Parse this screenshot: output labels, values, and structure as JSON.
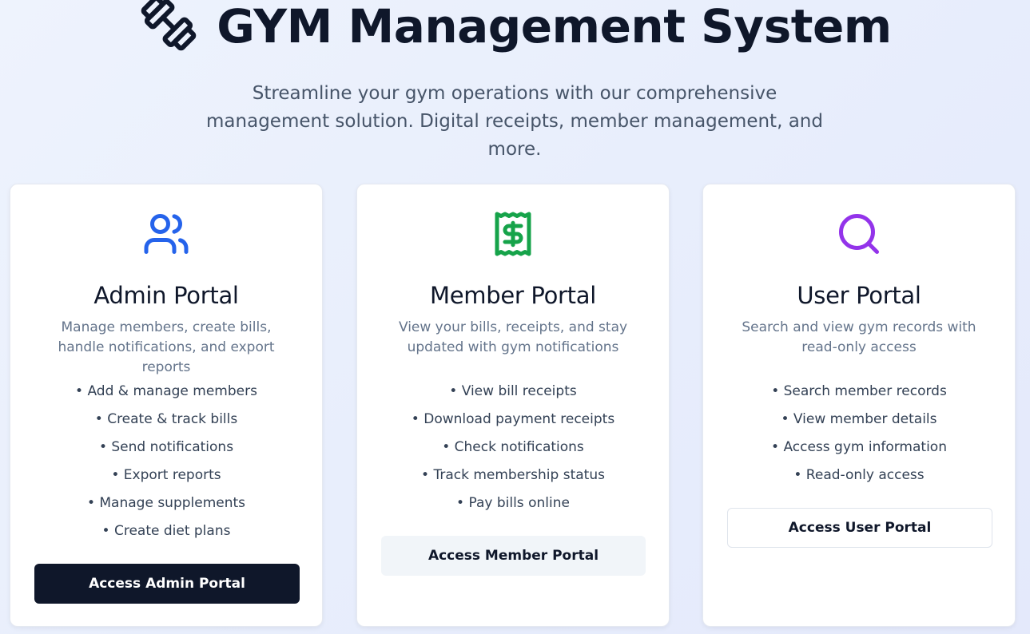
{
  "header": {
    "title": "GYM Management System",
    "subtitle": "Streamline your gym operations with our comprehensive management solution. Digital receipts, member management, and more.",
    "logo_icon": "dumbbell-icon"
  },
  "cards": [
    {
      "icon": "users-icon",
      "icon_color": "#2563eb",
      "title": "Admin Portal",
      "description": "Manage members, create bills, handle notifications, and export reports",
      "features": [
        "• Add & manage members",
        "• Create & track bills",
        "• Send notifications",
        "• Export reports",
        "• Manage supplements",
        "• Create diet plans"
      ],
      "button_label": "Access Admin Portal"
    },
    {
      "icon": "receipt-dollar-icon",
      "icon_color": "#16a34a",
      "title": "Member Portal",
      "description": "View your bills, receipts, and stay updated with gym notifications",
      "features": [
        "• View bill receipts",
        "• Download payment receipts",
        "• Check notifications",
        "• Track membership status",
        "• Pay bills online"
      ],
      "button_label": "Access Member Portal"
    },
    {
      "icon": "search-icon",
      "icon_color": "#9333ea",
      "title": "User Portal",
      "description": "Search and view gym records with read-only access",
      "features": [
        "• Search member records",
        "• View member details",
        "• Access gym information",
        "• Read-only access"
      ],
      "button_label": "Access User Portal"
    }
  ]
}
